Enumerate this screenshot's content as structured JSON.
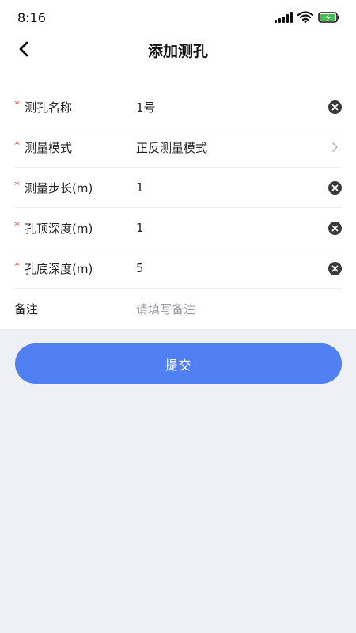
{
  "status": {
    "time": "8:16"
  },
  "header": {
    "title": "添加测孔"
  },
  "form": {
    "rows": [
      {
        "label": "测孔名称",
        "value": "1号",
        "required": true,
        "control": "clear"
      },
      {
        "label": "测量模式",
        "value": "正反测量模式",
        "required": true,
        "control": "chevron"
      },
      {
        "label": "测量步长(m)",
        "value": "1",
        "required": true,
        "control": "clear"
      },
      {
        "label": "孔顶深度(m)",
        "value": "1",
        "required": true,
        "control": "clear"
      },
      {
        "label": "孔底深度(m)",
        "value": "5",
        "required": true,
        "control": "clear"
      },
      {
        "label": "备注",
        "placeholder": "请填写备注",
        "required": false,
        "control": "none"
      }
    ],
    "required_mark": "*"
  },
  "actions": {
    "submit_label": "提交"
  },
  "colors": {
    "accent": "#4f7ff0",
    "required": "#e8453c",
    "background": "#eef0f6"
  },
  "icons": [
    "back-arrow-icon",
    "signal-icon",
    "wifi-icon",
    "battery-charging-icon",
    "clear-icon",
    "chevron-right-icon"
  ]
}
